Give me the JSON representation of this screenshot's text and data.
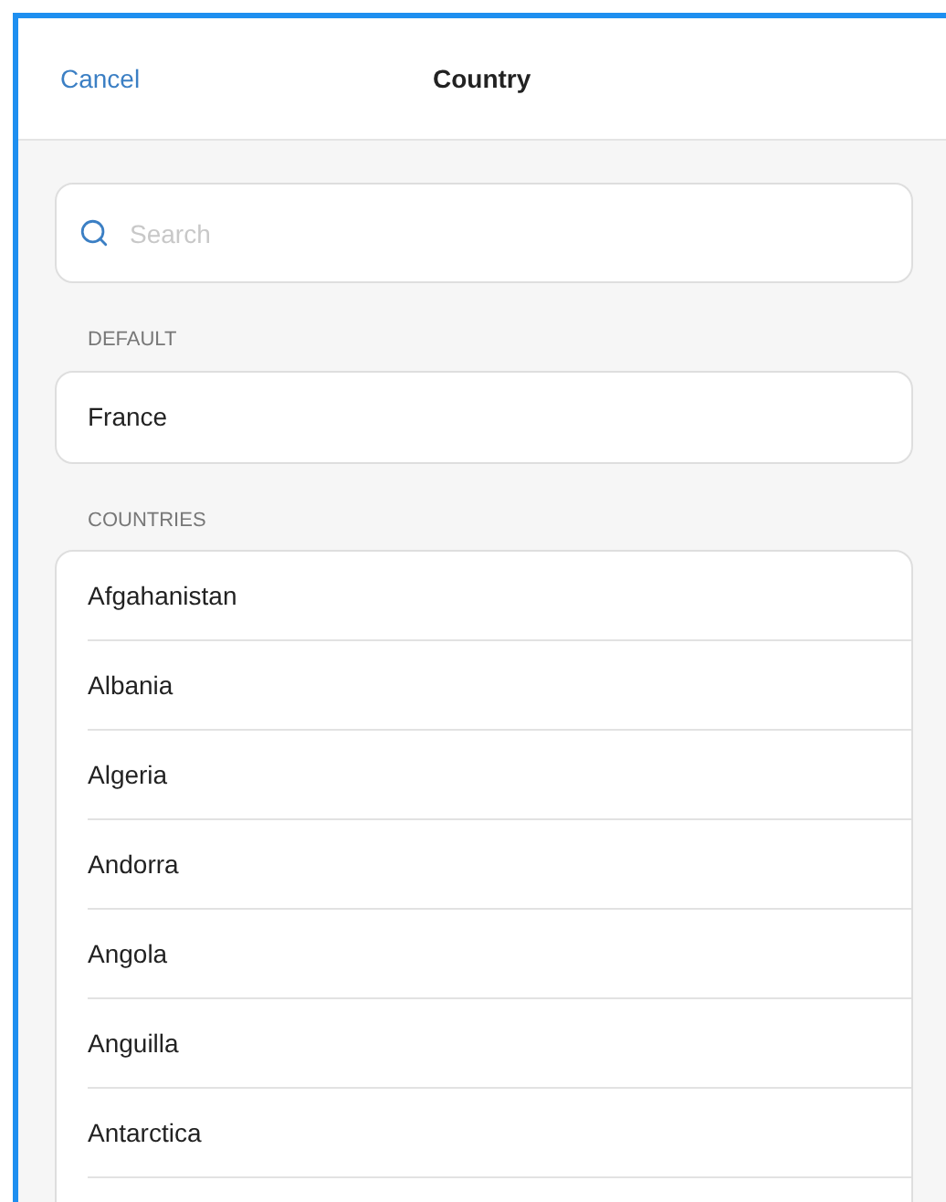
{
  "header": {
    "cancel": "Cancel",
    "title": "Country"
  },
  "search": {
    "placeholder": "Search"
  },
  "sections": [
    {
      "label": "DEFAULT",
      "items": [
        "France"
      ]
    },
    {
      "label": "COUNTRIES",
      "items": [
        "Afgahanistan",
        "Albania",
        "Algeria",
        "Andorra",
        "Angola",
        "Anguilla",
        "Antarctica"
      ]
    }
  ]
}
